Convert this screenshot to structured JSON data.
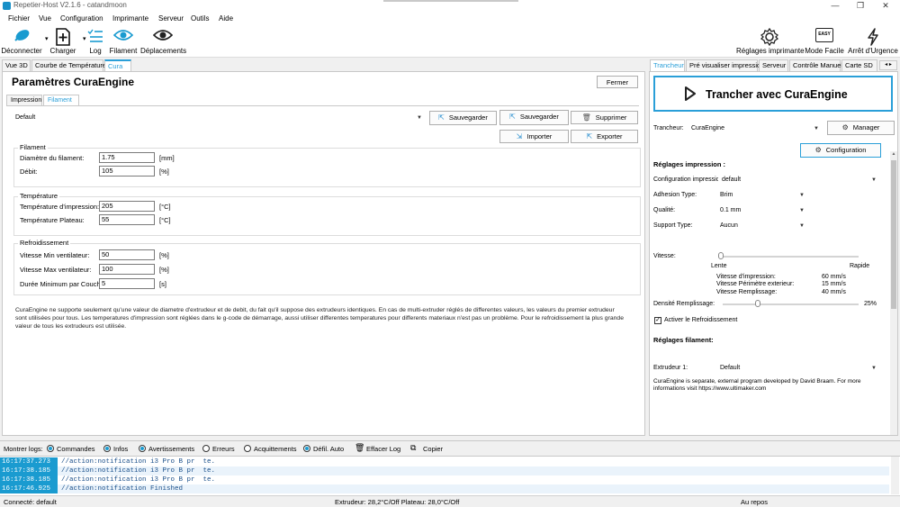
{
  "window": {
    "title": "Repetier-Host V2.1.6 - catandmoon",
    "min": "—",
    "max": "❐",
    "close": "✕"
  },
  "menu": [
    "Fichier",
    "Vue",
    "Configuration",
    "Imprimante",
    "Serveur",
    "Outils",
    "Aide"
  ],
  "toolbar": {
    "disconnect": "Déconnecter",
    "load": "Charger",
    "log": "Log",
    "filament": "Filament",
    "moves": "Déplacements",
    "printer_settings": "Réglages imprimante",
    "easy_mode": "Mode Facile",
    "easy_badge": "EASY",
    "emergency": "Arrêt d'Urgence"
  },
  "left_tabs": [
    "Vue 3D",
    "Courbe de Température",
    "Cura"
  ],
  "cura": {
    "title": "Paramètres CuraEngine",
    "close": "Fermer",
    "subtabs": [
      "Impression",
      "Filament"
    ],
    "profile": "Default",
    "save": "Sauvegarder",
    "save_as": "Sauvegarder",
    "delete": "Supprimer",
    "import": "Importer",
    "export": "Exporter",
    "filament_group": {
      "title": "Filament",
      "diameter_label": "Diamètre du filament:",
      "diameter_value": "1.75",
      "diameter_unit": "[mm]",
      "flow_label": "Débit:",
      "flow_value": "105",
      "flow_unit": "[%]"
    },
    "temp_group": {
      "title": "Température",
      "print_label": "Température d'impression:",
      "print_value": "205",
      "print_unit": "[°C]",
      "bed_label": "Température Plateau:",
      "bed_value": "55",
      "bed_unit": "[°C]"
    },
    "cool_group": {
      "title": "Refroidissement",
      "fan_min_label": "Vitesse Min ventilateur:",
      "fan_min_value": "50",
      "fan_min_unit": "[%]",
      "fan_max_label": "Vitesse Max ventilateur:",
      "fan_max_value": "100",
      "fan_max_unit": "[%]",
      "min_layer_label": "Durée Minimum par Couche:",
      "min_layer_value": "5",
      "min_layer_unit": "[s]"
    },
    "note": "CuraEngine ne supporte seulement qu'une valeur de diametre d'extrudeur et de debit, du fait qu'il suppose des extrudeurs identiques. En cas de multi-extruder réglés de differentes valeurs, les valeurs du premier extrudeur sont utilisées pour tous. Les temperatures d'impression sont réglées dans le g-code de démarrage, aussi utiliser differentes temperatures pour differents materiaux n'est pas un problème. Pour le refroidissement la plus grande valeur de tous les extrudeurs est utilisée."
  },
  "right_tabs": [
    "Trancheur",
    "Pré visualiser impression",
    "Serveur",
    "Contrôle Manuel",
    "Carte SD"
  ],
  "slicer": {
    "slice_button": "Trancher avec CuraEngine",
    "slicer_label": "Trancheur:",
    "slicer_value": "CuraEngine",
    "manager": "Manager",
    "configuration": "Configuration",
    "print_settings_head": "Réglages impression :",
    "print_config_label": "Configuration impression:",
    "print_config_value": "default",
    "adhesion_label": "Adhesion Type:",
    "adhesion_value": "Brim",
    "quality_label": "Qualité:",
    "quality_value": "0.1 mm",
    "support_label": "Support Type:",
    "support_value": "Aucun",
    "speed_label": "Vitesse:",
    "speed_slow": "Lente",
    "speed_fast": "Rapide",
    "speed_position": 0.0,
    "print_speed_label": "Vitesse d'impression:",
    "print_speed_value": "60 mm/s",
    "perimeter_label": "Vitesse Périmètre exterieur:",
    "perimeter_value": "15 mm/s",
    "infill_speed_label": "Vitesse Remplissage:",
    "infill_speed_value": "40 mm/s",
    "density_label": "Densité Remplissage:",
    "density_value": "25%",
    "density_position": 0.25,
    "cooling_checkbox": "Activer le Refroidissement",
    "cooling_checked": true,
    "filament_head": "Réglages filament:",
    "extruder_label": "Extrudeur 1:",
    "extruder_value": "Default",
    "info": "CuraEngine is separate, external program developed by David Braam. For more informations visit https://www.ultimaker.com"
  },
  "logbar": {
    "show_logs": "Montrer logs:",
    "commands": "Commandes",
    "infos": "Infos",
    "warnings": "Avertissements",
    "errors": "Erreurs",
    "acks": "Acquittements",
    "autoscroll": "Défil. Auto",
    "clear": "Effacer Log",
    "copy": "Copier"
  },
  "log": [
    {
      "time": "16:17:37.273",
      "msg": "//action:notification i3 Pro B pr  te."
    },
    {
      "time": "16:17:38.185",
      "msg": "//action:notification i3 Pro B pr  te."
    },
    {
      "time": "16:17:38.185",
      "msg": "//action:notification i3 Pro B pr  te."
    },
    {
      "time": "16:17:46.925",
      "msg": "//action:notification Finished"
    }
  ],
  "status": {
    "connection": "Connecté: default",
    "temps": "Extrudeur: 28,2°C/Off Plateau: 28,0°C/Off",
    "state": "Au repos"
  },
  "colors": {
    "accent": "#2a9fd8",
    "log_time_bg": "#1a9bd0"
  }
}
